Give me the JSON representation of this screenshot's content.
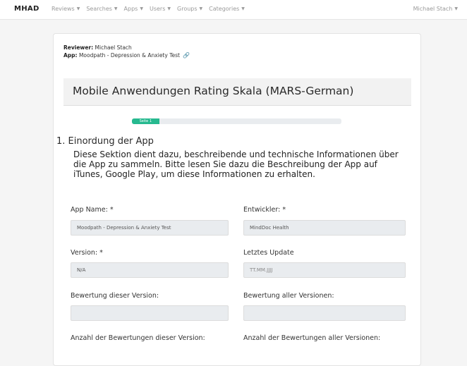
{
  "navbar": {
    "brand": "MHAD",
    "items": [
      {
        "label": "Reviews"
      },
      {
        "label": "Searches"
      },
      {
        "label": "Apps"
      },
      {
        "label": "Users"
      },
      {
        "label": "Groups"
      },
      {
        "label": "Categories"
      }
    ],
    "user": "Michael Stach",
    "caret_icon": "caret-down-icon"
  },
  "review": {
    "reviewer_label": "Reviewer:",
    "reviewer_value": "Michael Stach",
    "app_label": "App:",
    "app_value": "Moodpath - Depression & Anxiety Test",
    "link_icon": "link-icon"
  },
  "form": {
    "title": "Mobile Anwendungen Rating Skala (MARS-German)",
    "progress": {
      "label": "Seite 1",
      "fraction": 0.13
    },
    "section_title": "1. Einordung der App",
    "section_description": "Diese Sektion dient dazu, beschreibende und technische Informationen über die App zu sammeln. Bitte lesen Sie dazu die Beschreibung der App auf iTunes, Google Play, um diese Informationen zu erhalten.",
    "fields": {
      "app_name": {
        "label": "App Name: *",
        "value": "Moodpath - Depression & Anxiety Test"
      },
      "developer": {
        "label": "Entwickler: *",
        "value": "MindDoc Health"
      },
      "version": {
        "label": "Version: *",
        "value": "N/A"
      },
      "last_update": {
        "label": "Letztes Update",
        "placeholder": "TT.MM.JJJJ"
      },
      "rating_this_version": {
        "label": "Bewertung dieser Version:",
        "value": ""
      },
      "rating_all_versions": {
        "label": "Bewertung aller Versionen:",
        "value": ""
      },
      "count_this_version": {
        "label": "Anzahl der Bewertungen dieser Version:"
      },
      "count_all_versions": {
        "label": "Anzahl der Bewertungen aller Versionen:"
      }
    }
  },
  "colors": {
    "progress": "#26b98f",
    "link": "#2d7ff9"
  }
}
